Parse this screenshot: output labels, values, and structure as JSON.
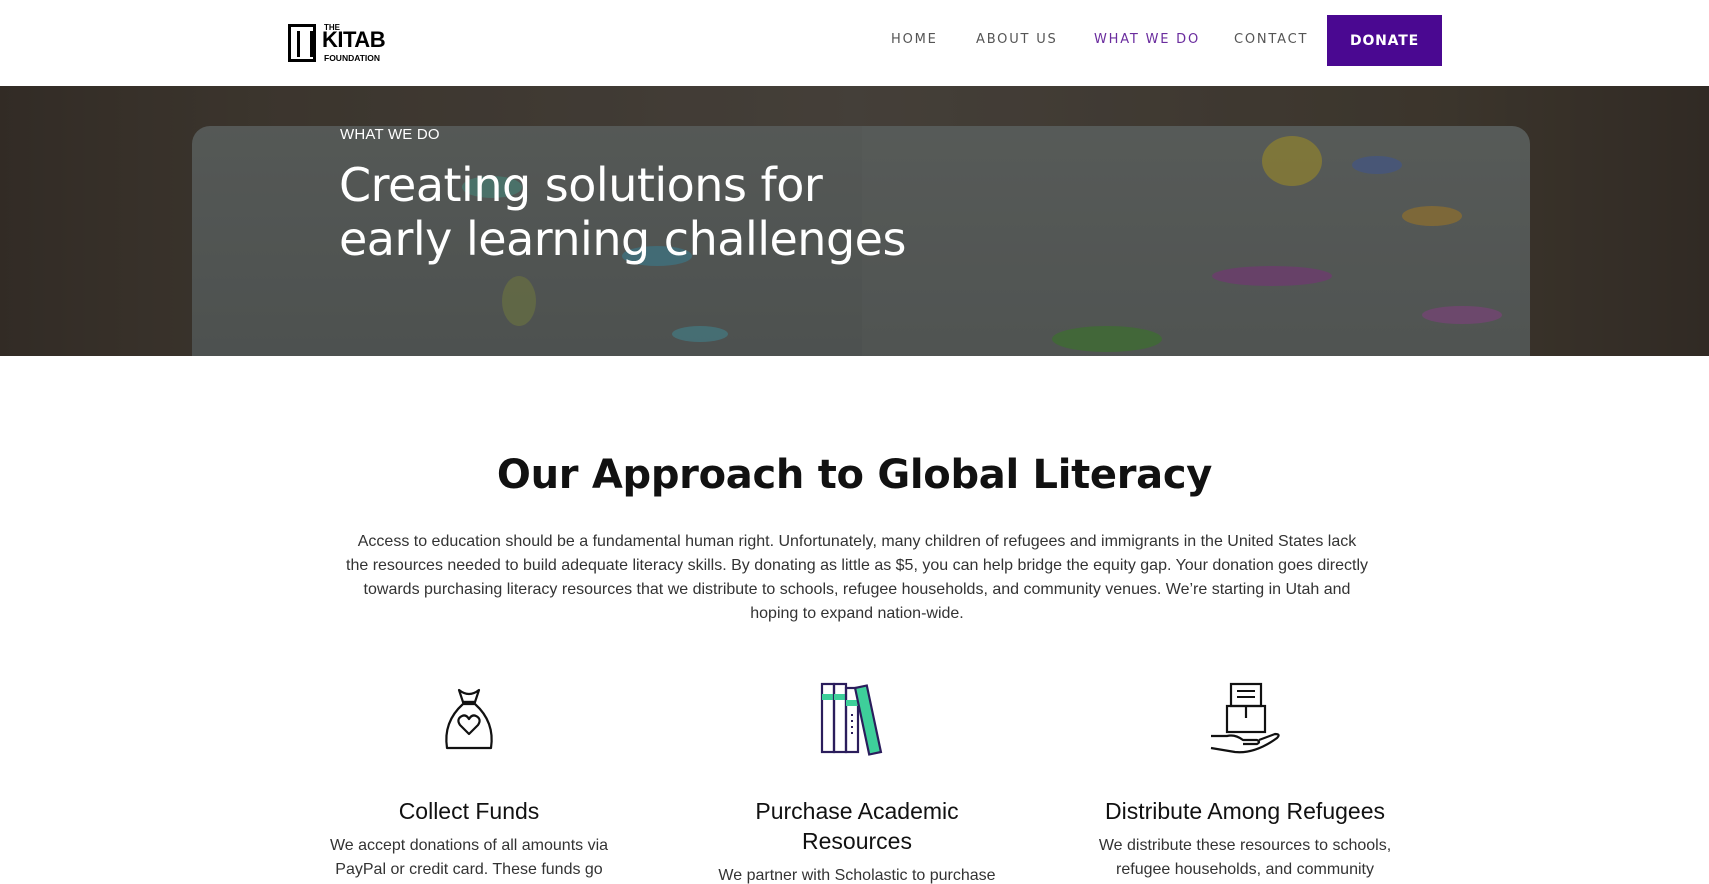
{
  "header": {
    "logo": {
      "the": "THE",
      "name": "KITAB",
      "sub": "FOUNDATION"
    },
    "nav": [
      {
        "label": "HOME",
        "active": false
      },
      {
        "label": "ABOUT US",
        "active": false
      },
      {
        "label": "WHAT WE DO",
        "active": true
      },
      {
        "label": "CONTACT",
        "active": false
      }
    ],
    "donate_label": "DONATE"
  },
  "hero": {
    "kicker": "WHAT WE DO",
    "title_line1": "Creating solutions for",
    "title_line2": "early learning challenges"
  },
  "approach": {
    "title": "Our Approach to Global Literacy",
    "intro": "Access to education should be a fundamental human right. Unfortunately, many children of refugees and immigrants in the United States lack the resources needed to build adequate literacy skills. By donating as little as $5, you can help bridge the equity gap. Your donation goes directly towards purchasing literacy resources that we distribute to schools, refugee households, and community venues. We’re starting in Utah and hoping to expand nation-wide.",
    "cards": [
      {
        "icon": "money-bag-heart-icon",
        "title": "Collect Funds",
        "text": "We accept donations of all amounts via PayPal or credit card. These funds go"
      },
      {
        "icon": "books-icon",
        "title": "Purchase Academic Resources",
        "text": "We partner with Scholastic to purchase"
      },
      {
        "icon": "hand-box-icon",
        "title": "Distribute Among Refugees",
        "text": "We distribute these resources to schools, refugee households, and community"
      }
    ]
  },
  "colors": {
    "brand": "#4a0891",
    "nav_active": "#6a2c9e",
    "icon_accent": "#3ecf9a"
  }
}
